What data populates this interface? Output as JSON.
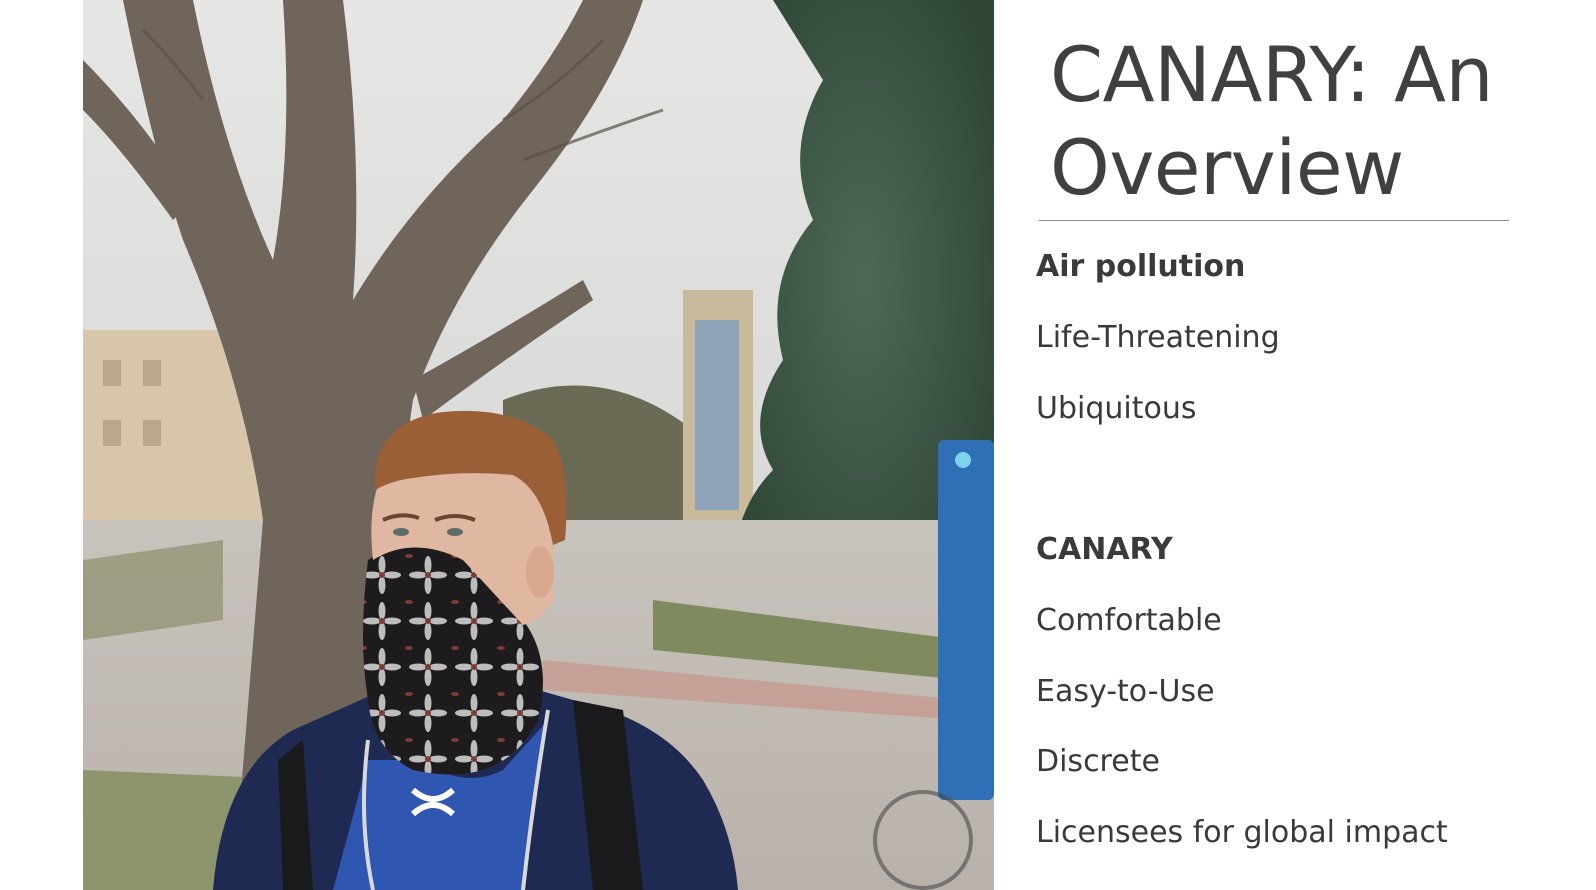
{
  "slide": {
    "title": "CANARY: An Overview",
    "photo_icon": "person-wearing-face-mask-photo",
    "logo_icon": "under-armour-logo",
    "section1": {
      "heading": "Air pollution",
      "items": [
        "Life-Threatening",
        "Ubiquitous"
      ]
    },
    "section2": {
      "heading": "CANARY",
      "items": [
        "Comfortable",
        "Easy-to-Use",
        "Discrete",
        "Licensees for global impact"
      ]
    }
  },
  "colors": {
    "title_text": "#404040",
    "body_text": "#3a3a3a",
    "rule": "#8a8a8a",
    "jacket": "#1f2a52",
    "shirt": "#2f56b0"
  }
}
